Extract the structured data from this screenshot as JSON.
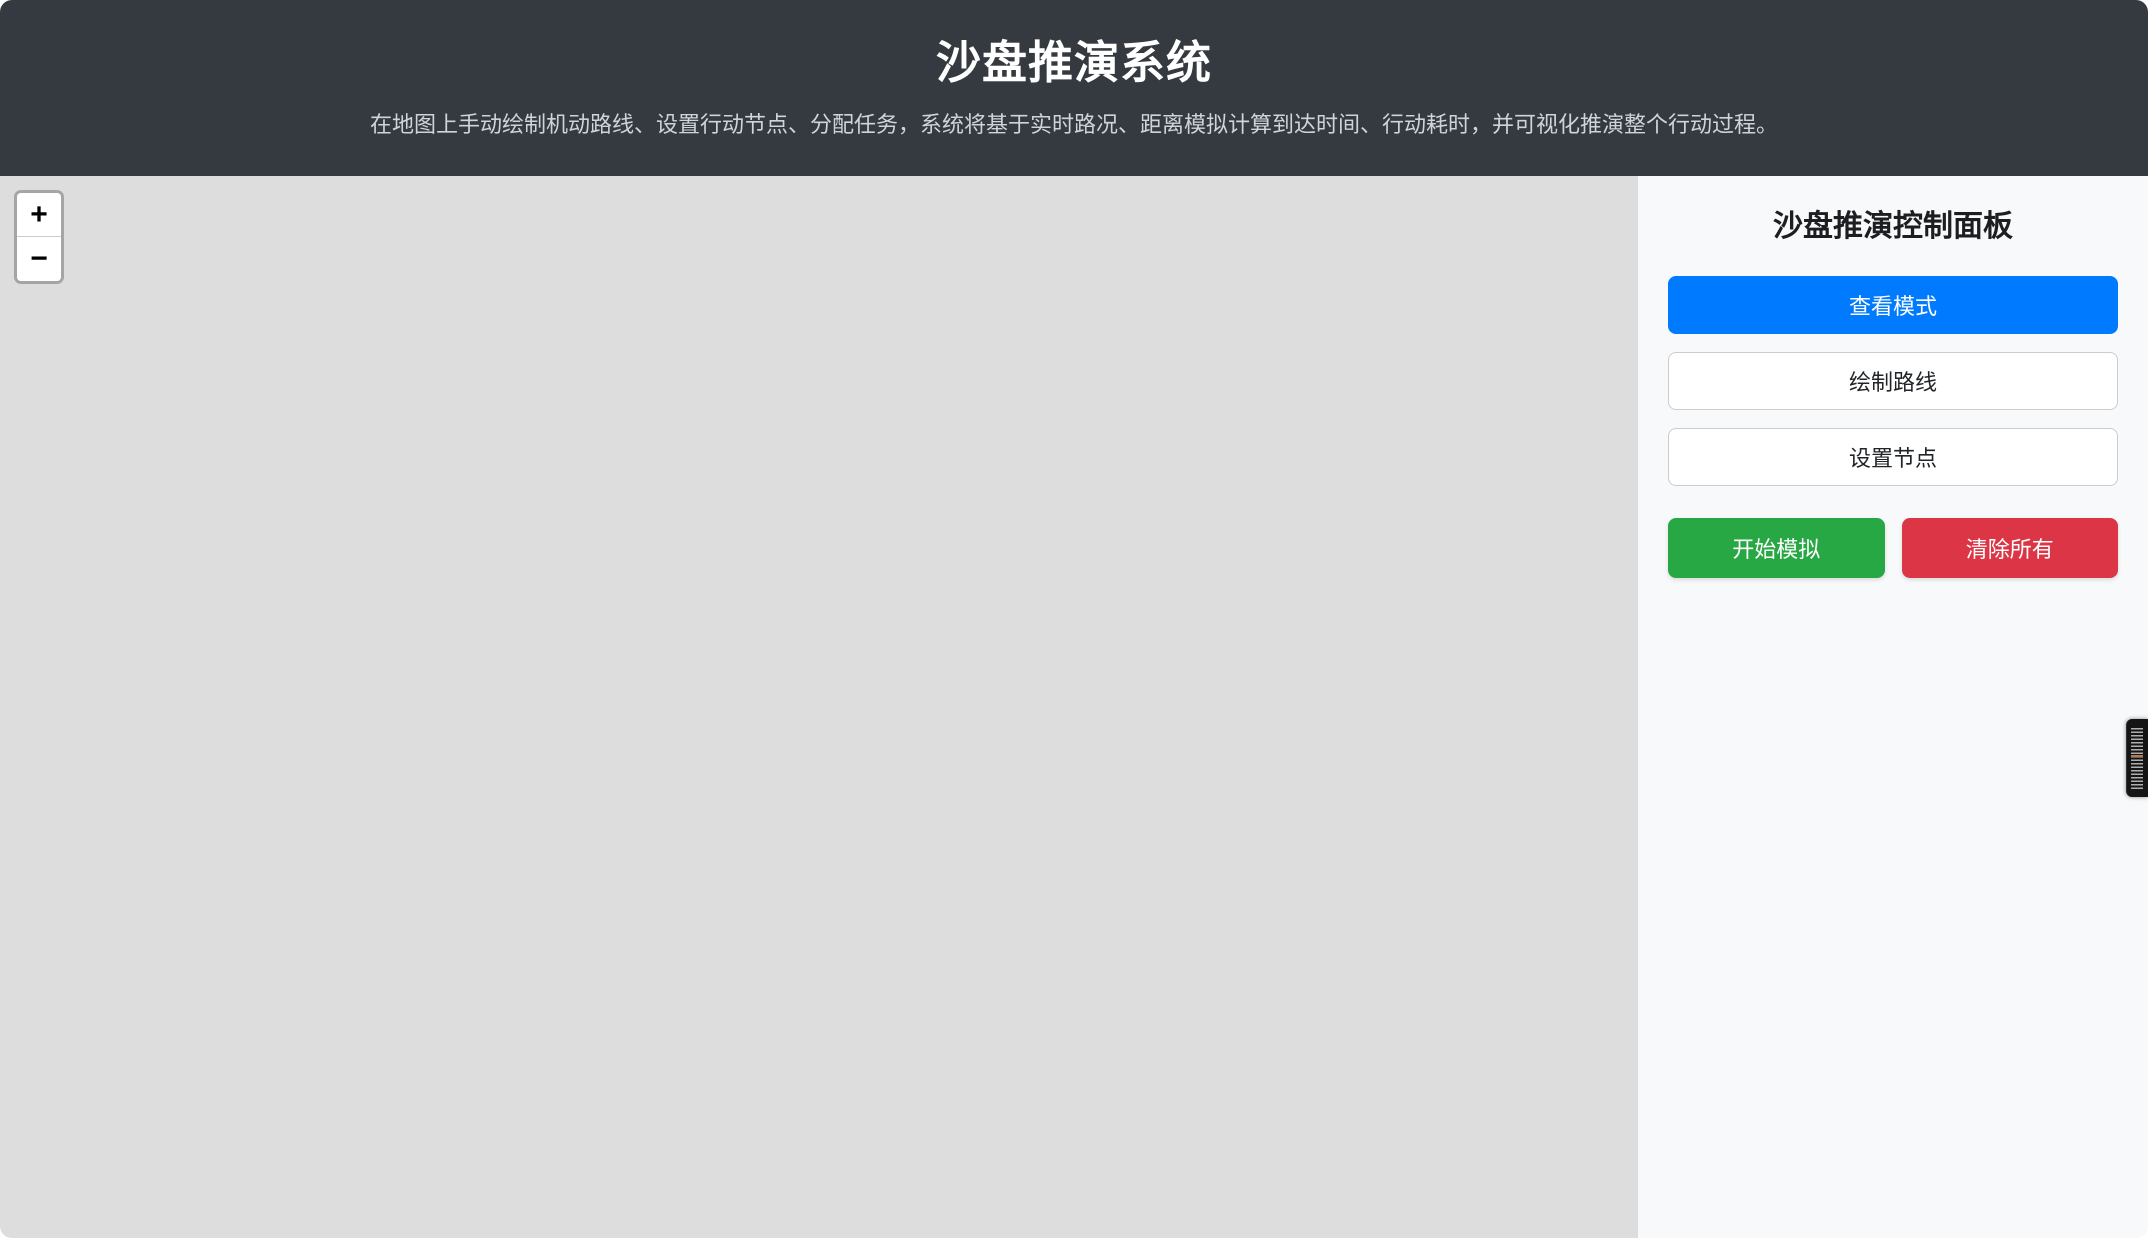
{
  "header": {
    "title": "沙盘推演系统",
    "subtitle": "在地图上手动绘制机动路线、设置行动节点、分配任务，系统将基于实时路况、距离模拟计算到达时间、行动耗时，并可视化推演整个行动过程。"
  },
  "map": {
    "zoom_in_label": "+",
    "zoom_out_label": "−"
  },
  "panel": {
    "title": "沙盘推演控制面板",
    "buttons": {
      "view_mode": "查看模式",
      "draw_route": "绘制路线",
      "set_node": "设置节点",
      "start_simulation": "开始模拟",
      "clear_all": "清除所有"
    }
  },
  "colors": {
    "header_bg": "#343a40",
    "map_bg": "#dddddd",
    "panel_bg": "#f8f9fa",
    "primary_blue": "#007bff",
    "success_green": "#28a745",
    "danger_red": "#dc3545",
    "subtitle_text": "#ced4da",
    "ruler_accent": "#b97a4b"
  }
}
